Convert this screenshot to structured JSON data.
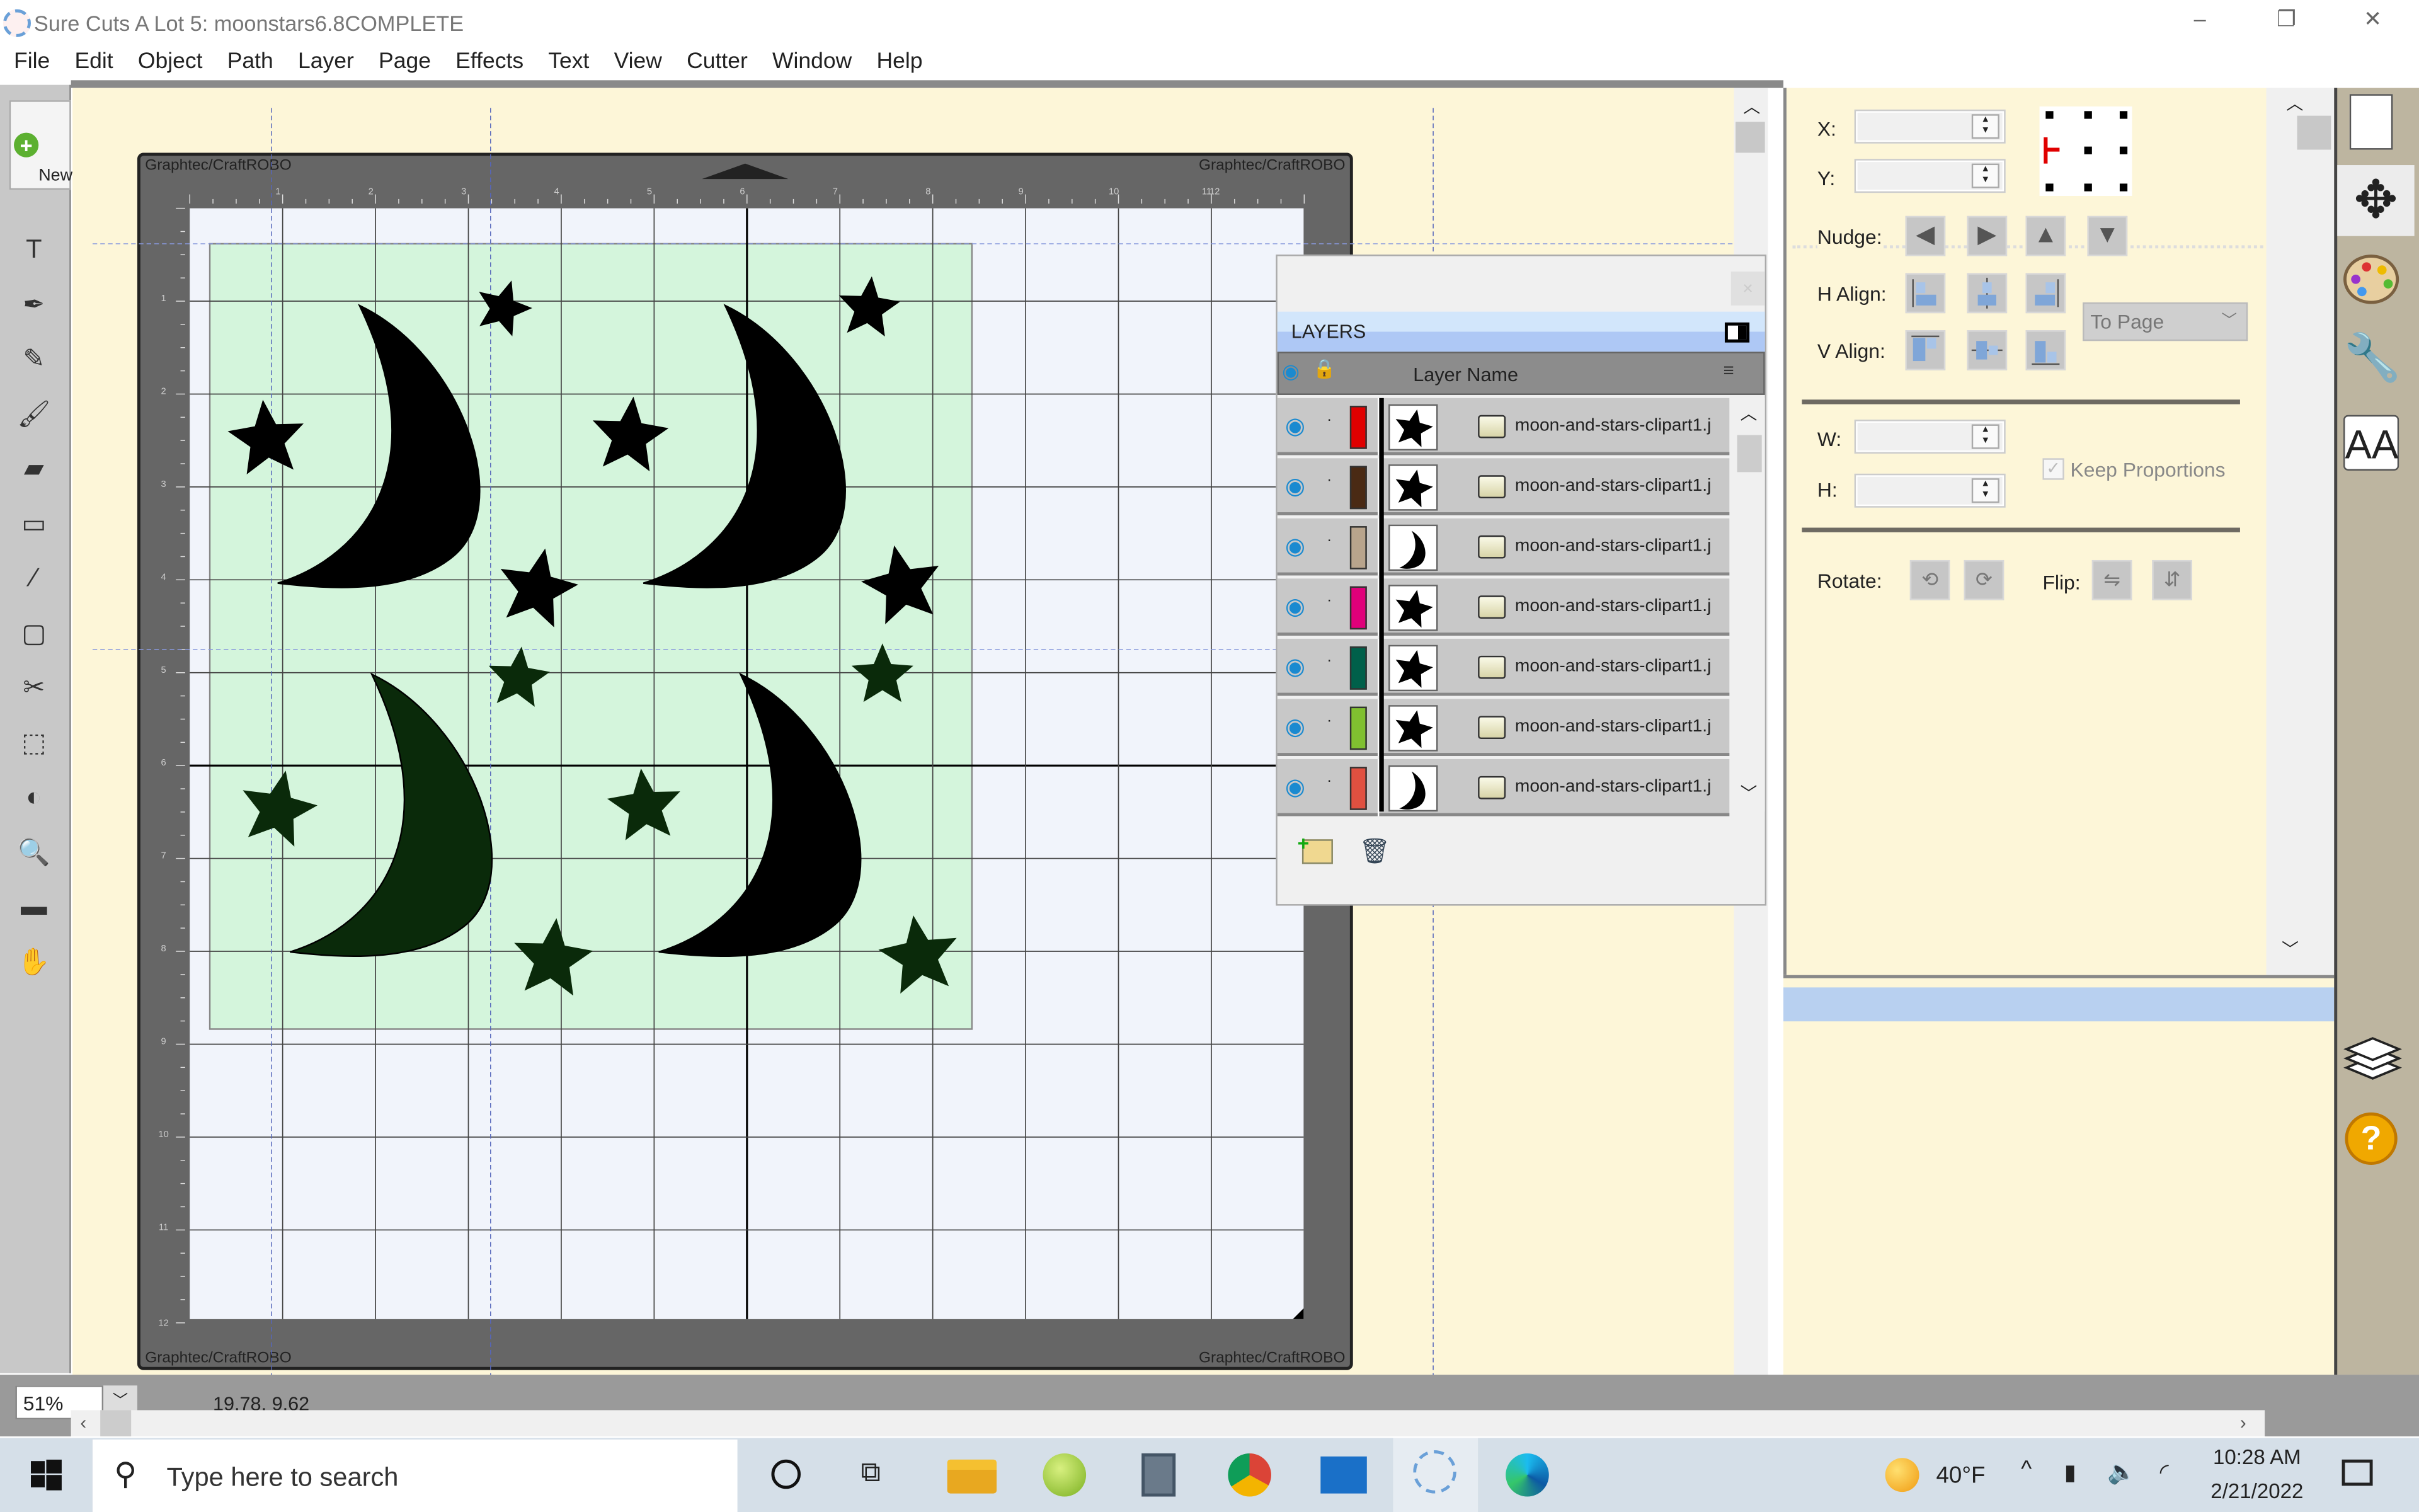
{
  "window": {
    "title": "Sure Cuts A Lot 5: moonstars6.8COMPLETE",
    "minimize": "–",
    "restore": "❐",
    "close": "✕"
  },
  "menu": [
    "File",
    "Edit",
    "Object",
    "Path",
    "Layer",
    "Page",
    "Effects",
    "Text",
    "View",
    "Cutter",
    "Window",
    "Help"
  ],
  "toolbar": {
    "new_label": "New",
    "tools": [
      "text-tool",
      "pen-tool",
      "pencil-tool",
      "brush-tool",
      "eraser-tool",
      "rectangle-tool",
      "eyedropper-tool",
      "fill-tool",
      "knife-tool",
      "node-edit-tool",
      "weld-tool",
      "zoom-tool",
      "ruler-tool",
      "hand-tool"
    ]
  },
  "mat": {
    "brand_top_left": "Graphtec/CraftROBO",
    "brand_top_right": "Graphtec/CraftROBO",
    "brand_bottom_left": "Graphtec/CraftROBO",
    "brand_bottom_right": "Graphtec/CraftROBO",
    "ruler_ticks": [
      "1",
      "2",
      "3",
      "4",
      "5",
      "6",
      "7",
      "8",
      "9",
      "10",
      "11",
      "12"
    ]
  },
  "design": {
    "moon_colors": [
      "#000000",
      "#000000",
      "#0a2a0a",
      "#000000"
    ],
    "star_color_top": "#000000",
    "star_color_bottom": "#0a2a0a",
    "area_color": "#d4f5dc"
  },
  "layers": {
    "title": "LAYERS",
    "column_header": "Layer Name",
    "rows": [
      {
        "name": "moon-and-stars-clipart1.j",
        "color": "#e00000",
        "thumb": "star"
      },
      {
        "name": "moon-and-stars-clipart1.j",
        "color": "#4a2a14",
        "thumb": "star"
      },
      {
        "name": "moon-and-stars-clipart1.j",
        "color": "#b8a48c",
        "thumb": "moon"
      },
      {
        "name": "moon-and-stars-clipart1.j",
        "color": "#e0007a",
        "thumb": "star"
      },
      {
        "name": "moon-and-stars-clipart1.j",
        "color": "#00604a",
        "thumb": "star"
      },
      {
        "name": "moon-and-stars-clipart1.j",
        "color": "#80c030",
        "thumb": "star"
      },
      {
        "name": "moon-and-stars-clipart1.j",
        "color": "#e05040",
        "thumb": "moon"
      }
    ]
  },
  "transform": {
    "x_label": "X:",
    "y_label": "Y:",
    "x_value": "",
    "y_value": "",
    "nudge_label": "Nudge:",
    "halign_label": "H Align:",
    "valign_label": "V Align:",
    "align_to": "To Page",
    "w_label": "W:",
    "h_label": "H:",
    "w_value": "",
    "h_value": "",
    "keep_proportions": "Keep Proportions",
    "keep_proportions_checked": true,
    "rotate_label": "Rotate:",
    "flip_label": "Flip:"
  },
  "status": {
    "zoom": "51%",
    "coords": "19.78, 9.62"
  },
  "taskbar": {
    "search_placeholder": "Type here to search",
    "weather": "40°F",
    "time": "10:28 AM",
    "date": "2/21/2022"
  }
}
